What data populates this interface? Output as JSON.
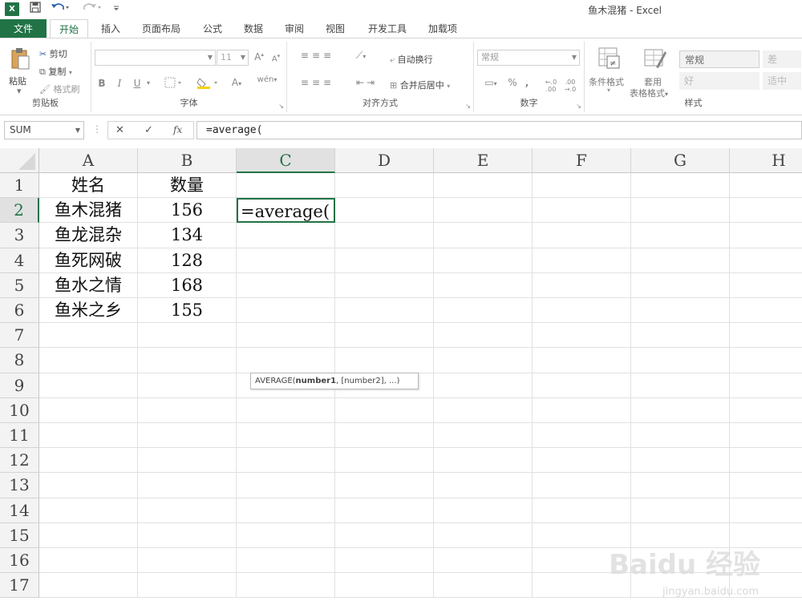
{
  "window": {
    "title": "鱼木混猪 - Excel"
  },
  "quick_access": {
    "logo": "X",
    "save_icon": "save-icon",
    "undo_icon": "undo-icon",
    "redo_icon": "redo-icon"
  },
  "tabs": [
    "文件",
    "开始",
    "插入",
    "页面布局",
    "公式",
    "数据",
    "审阅",
    "视图",
    "开发工具",
    "加载项"
  ],
  "ribbon": {
    "clipboard": {
      "label": "剪贴板",
      "paste": "粘贴",
      "cut": "剪切",
      "copy": "复制",
      "format_painter": "格式刷"
    },
    "font": {
      "label": "字体",
      "size": "11",
      "bold": "B",
      "italic": "I",
      "underline": "U"
    },
    "alignment": {
      "label": "对齐方式",
      "wrap": "自动换行",
      "merge": "合并后居中"
    },
    "number": {
      "label": "数字",
      "format": "常规",
      "percent": "%",
      "comma": ","
    },
    "styles": {
      "label": "样式",
      "conditional": "条件格式",
      "table_format_1": "套用",
      "table_format_2": "表格格式",
      "normal": "常规",
      "bad": "差",
      "good": "好",
      "neutral": "适中"
    }
  },
  "formula_bar": {
    "name_box": "SUM",
    "cancel": "✕",
    "enter": "✓",
    "fx": "fx",
    "formula": "=average("
  },
  "columns": [
    "A",
    "B",
    "C",
    "D",
    "E",
    "F",
    "G",
    "H"
  ],
  "rows": [
    "1",
    "2",
    "3",
    "4",
    "5",
    "6",
    "7",
    "8",
    "9",
    "10",
    "11",
    "12",
    "13",
    "14",
    "15",
    "16",
    "17"
  ],
  "cells": {
    "A1": "姓名",
    "B1": "数量",
    "A2": "鱼木混猪",
    "B2": "156",
    "A3": "鱼龙混杂",
    "B3": "134",
    "A4": "鱼死网破",
    "B4": "128",
    "A5": "鱼水之情",
    "B5": "168",
    "A6": "鱼米之乡",
    "B6": "155",
    "C2": "=average("
  },
  "tooltip": {
    "fn": "AVERAGE(",
    "arg1": "number1",
    "rest": ", [number2], ...)"
  },
  "watermark": {
    "main": "Baidu 经验",
    "sub": "jingyan.baidu.com"
  },
  "colors": {
    "accent": "#217346"
  }
}
